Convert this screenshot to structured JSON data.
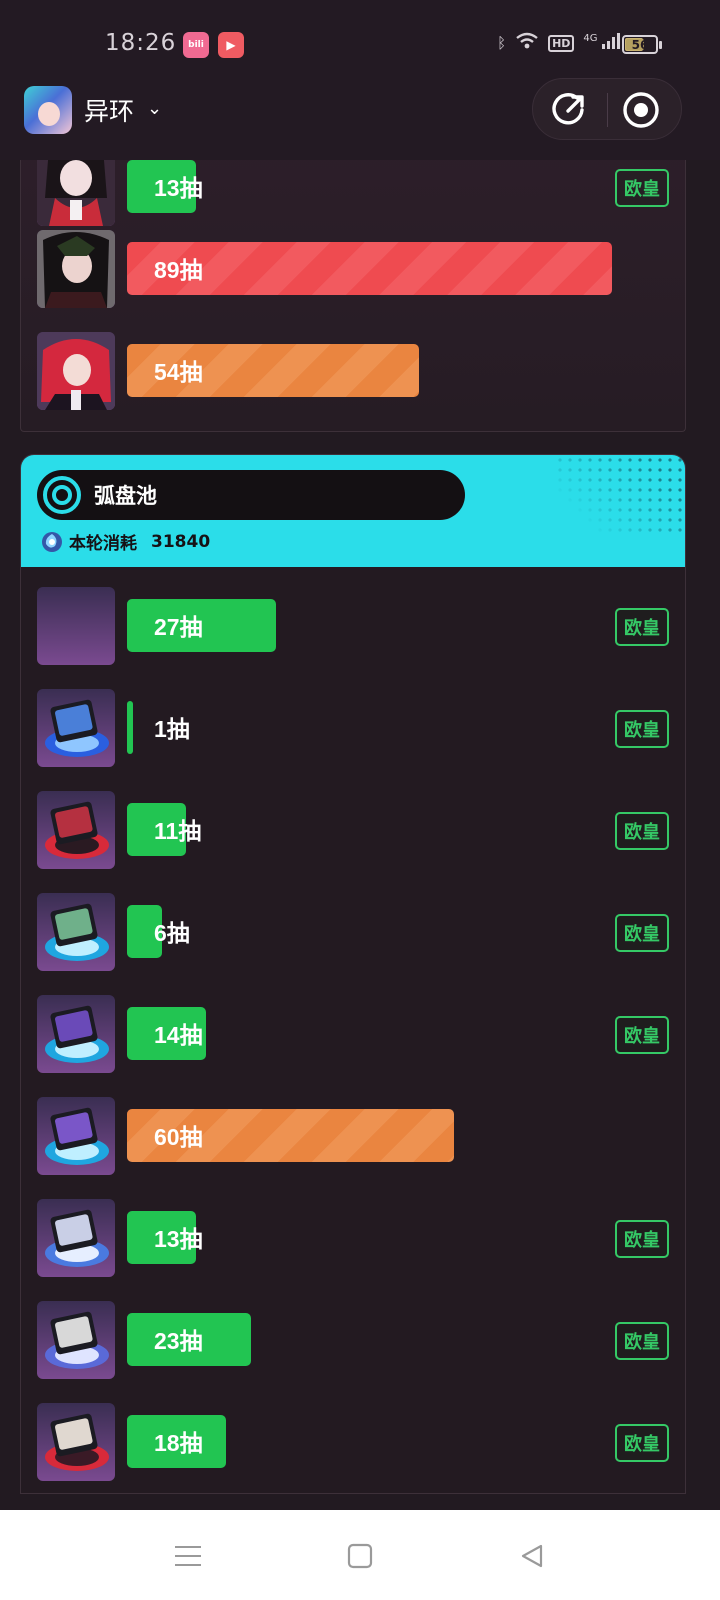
{
  "status_bar": {
    "time": "18:26",
    "app_badges": [
      {
        "icon": "bilibili-icon",
        "color": "#f06a92"
      },
      {
        "icon": "video-play-icon",
        "color": "#ef5b62"
      }
    ],
    "indicators": [
      "bluetooth-icon",
      "wifi-icon",
      "hd-icon",
      "signal-4g-icon"
    ],
    "hd_label": "HD",
    "network_label": "4G",
    "battery": "56"
  },
  "header": {
    "game_name": "异环",
    "actions": [
      "share-icon",
      "record-icon"
    ]
  },
  "top_panel": {
    "rows": [
      {
        "count_label": "13抽",
        "color": "green",
        "fill": 0.14,
        "tag": "欧皇"
      },
      {
        "count_label": "89抽",
        "color": "red",
        "fill": 0.98,
        "tag": ""
      },
      {
        "count_label": "54抽",
        "color": "orange",
        "fill": 0.59,
        "tag": ""
      }
    ]
  },
  "pool": {
    "name": "弧盘池",
    "spend_label": "本轮消耗",
    "spend_value": "31840",
    "accent_color": "#2bdde9",
    "rows": [
      {
        "count_label": "27抽",
        "color": "green",
        "fill": 0.3,
        "tag": "欧皇"
      },
      {
        "count_label": "1抽",
        "color": "green",
        "fill": 0.01,
        "tag": "欧皇"
      },
      {
        "count_label": "11抽",
        "color": "green",
        "fill": 0.12,
        "tag": "欧皇"
      },
      {
        "count_label": "6抽",
        "color": "green",
        "fill": 0.07,
        "tag": "欧皇"
      },
      {
        "count_label": "14抽",
        "color": "green",
        "fill": 0.16,
        "tag": "欧皇"
      },
      {
        "count_label": "60抽",
        "color": "orange",
        "fill": 0.66,
        "tag": ""
      },
      {
        "count_label": "13抽",
        "color": "green",
        "fill": 0.14,
        "tag": "欧皇"
      },
      {
        "count_label": "23抽",
        "color": "green",
        "fill": 0.25,
        "tag": "欧皇"
      },
      {
        "count_label": "18抽",
        "color": "green",
        "fill": 0.2,
        "tag": "欧皇"
      }
    ]
  },
  "colors": {
    "green": "#22c552",
    "red": "#ef4b50",
    "orange": "#ea8540",
    "tag_green": "#35c966"
  },
  "nav": [
    "menu-icon",
    "home-icon",
    "back-icon"
  ]
}
